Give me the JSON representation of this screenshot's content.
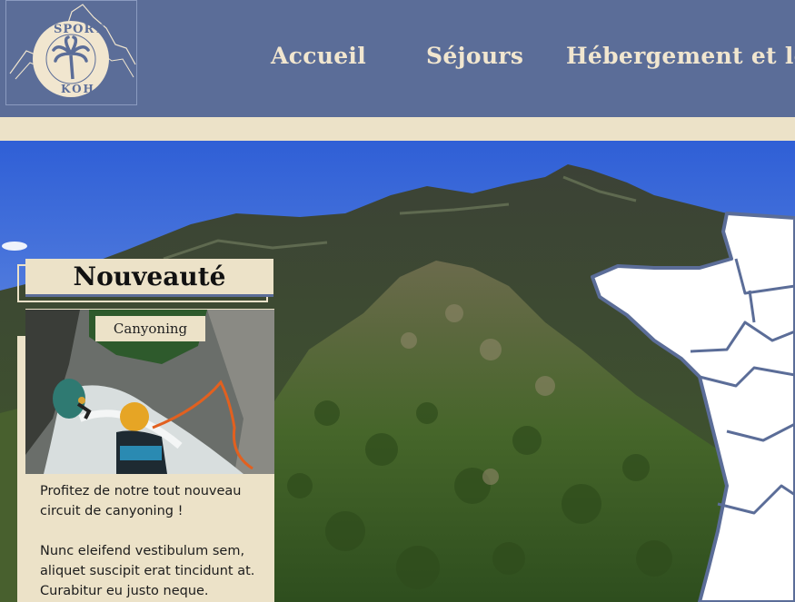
{
  "logo": {
    "text_top": "SPORT",
    "text_bottom": "KOH"
  },
  "nav": [
    {
      "label": "Accueil"
    },
    {
      "label": "Séjours"
    },
    {
      "label": "Hébergement et loc"
    }
  ],
  "news_card": {
    "title": "Nouveauté",
    "tag": "Canyoning",
    "paragraphs": [
      "Profitez de notre tout nouveau circuit de canyoning !",
      "Nunc eleifend vestibulum sem, aliquet suscipit erat tincidunt at. Curabitur eu justo neque."
    ]
  },
  "colors": {
    "header_bg": "#5b6d98",
    "cream": "#ece2c8",
    "map_fill": "#ffffff",
    "map_border": "#5b6d98"
  },
  "icons": [
    "palm-tree-icon",
    "mountain-icon"
  ]
}
